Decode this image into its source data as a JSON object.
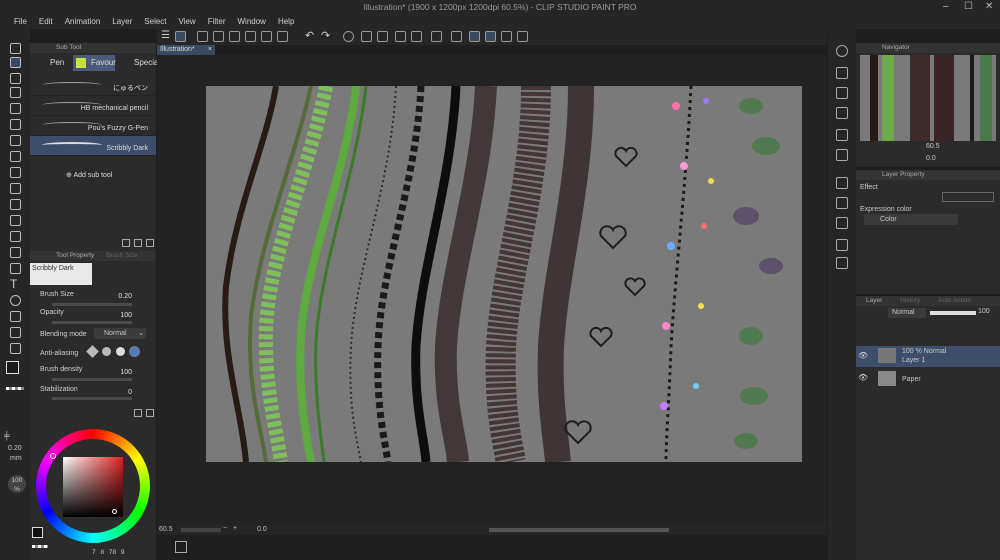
{
  "window": {
    "title": "Illustration* (1900 x 1200px 1200dpi 60.5%) - CLIP STUDIO PAINT PRO"
  },
  "menu": [
    "File",
    "Edit",
    "Animation",
    "Layer",
    "Select",
    "View",
    "Filter",
    "Window",
    "Help"
  ],
  "document_tab": "Illustration*",
  "subtool": {
    "panel_title": "Sub Tool",
    "tabs": [
      "Pen",
      "Favour",
      "Special"
    ],
    "brushes": [
      "にゅるペン",
      "HB mechanical pencil",
      "Pou's Fuzzy G-Pen",
      "Scribbly Dark"
    ],
    "selected_brush": "Scribbly Dark",
    "add_label": "Add sub tool"
  },
  "tool_property": {
    "panel_title": "Tool Property",
    "tab2": "Brush Size",
    "preview_name": "Scribbly Dark",
    "brush_size_label": "Brush Size",
    "brush_size": "0.20",
    "opacity_label": "Opacity",
    "opacity": "100",
    "blending_label": "Blending mode",
    "blending": "Normal",
    "antialias_label": "Anti-aliasing",
    "density_label": "Brush density",
    "density": "100",
    "stabilization_label": "Stabilization",
    "stabilization": "0"
  },
  "color": {
    "size": "0.20",
    "size_unit": "mm",
    "percent": "100",
    "percent_unit": "%",
    "bottom_vals": [
      "7",
      "8",
      "78",
      "9"
    ]
  },
  "status": {
    "zoom": "60.5",
    "angle": "0.0"
  },
  "navigator": {
    "title": "Navigator",
    "zoom": "60.5",
    "angle": "0.0"
  },
  "layer_property": {
    "title": "Layer Property",
    "effect_label": "Effect",
    "expression_label": "Expression color",
    "expression_value": "Color"
  },
  "layers": {
    "tabs": [
      "Layer",
      "History",
      "Auto Action"
    ],
    "blend": "Normal",
    "opacity": "100",
    "items": [
      {
        "name": "100 % Normal",
        "sub": "Layer 1"
      },
      {
        "name": "Paper",
        "sub": ""
      }
    ]
  },
  "colors": {
    "accent": "#5a7bb0",
    "selected_row": "#3d4e6b",
    "canvas_bg": "#7a7a7a",
    "panel": "#2b2b2b"
  }
}
